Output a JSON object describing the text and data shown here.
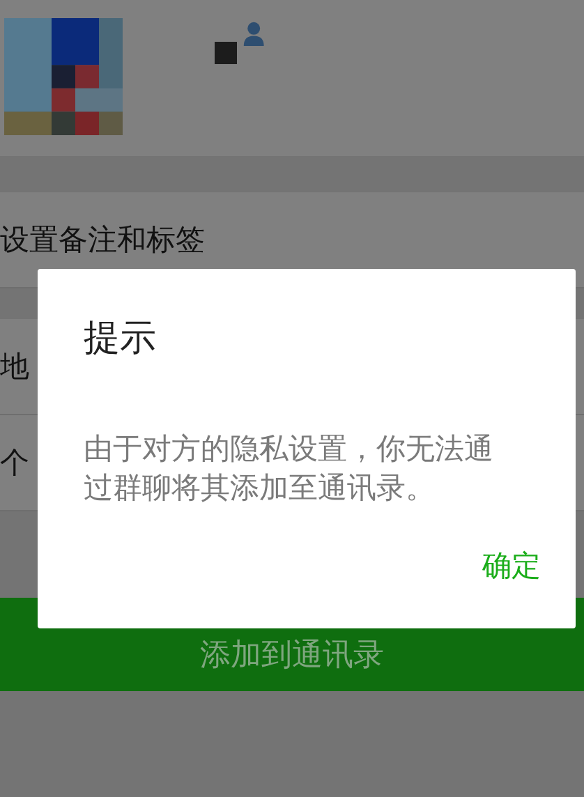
{
  "background": {
    "sections": [
      [
        {
          "label": "设置备注和标签"
        }
      ],
      [
        {
          "label": "地"
        },
        {
          "label": "个"
        }
      ]
    ],
    "add_button": "添加到通讯录"
  },
  "dialog": {
    "title": "提示",
    "message": "由于对方的隐私设置，你无法通过群聊将其添加至通讯录。",
    "confirm": "确定"
  }
}
